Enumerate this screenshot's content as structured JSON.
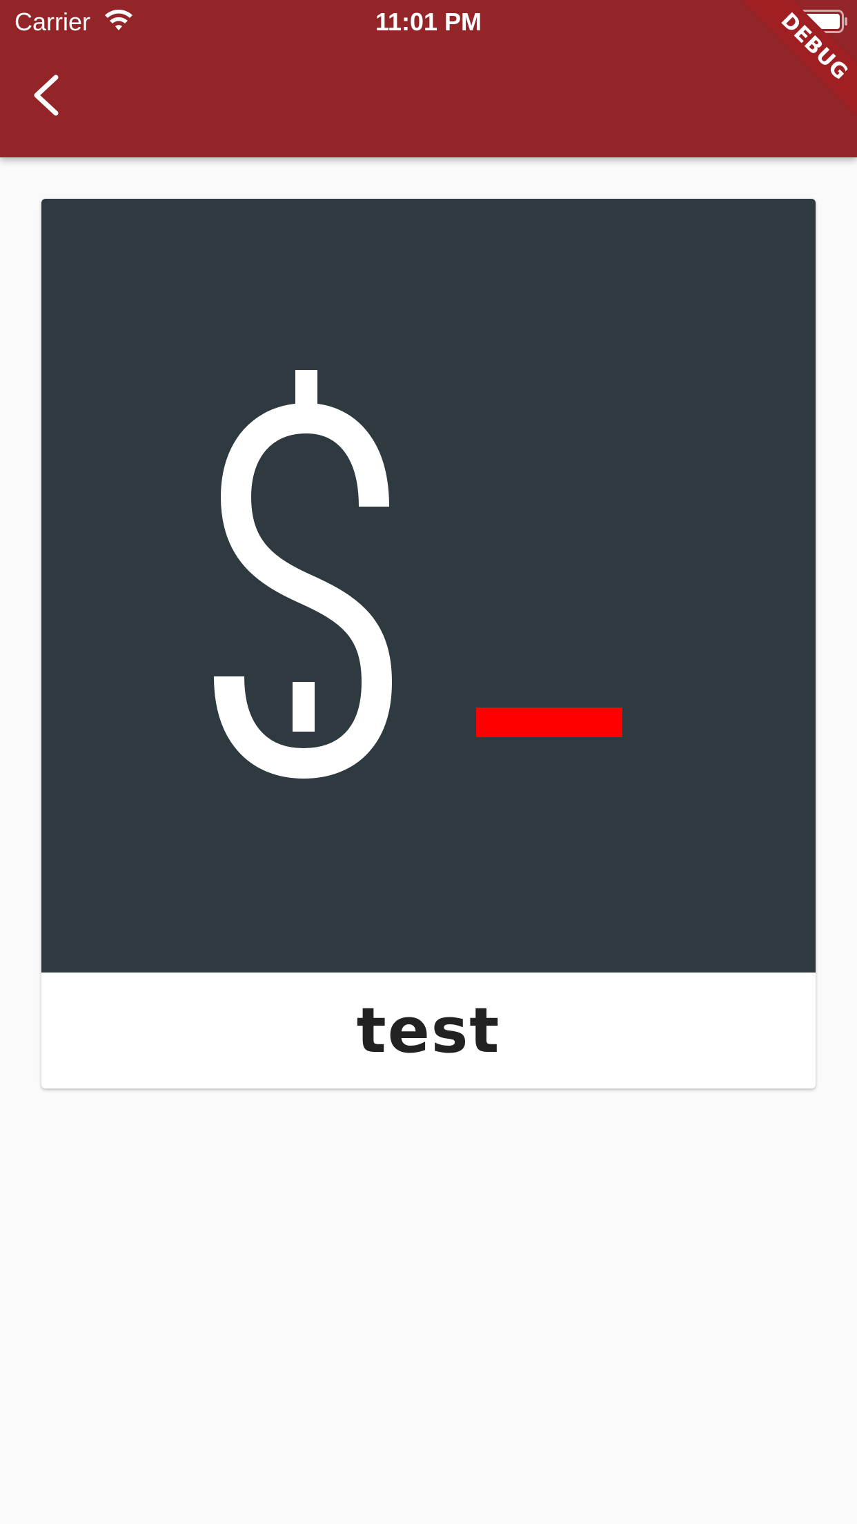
{
  "status_bar": {
    "carrier": "Carrier",
    "time": "11:01 PM",
    "wifi_icon": "wifi-icon",
    "battery_icon": "battery-icon"
  },
  "app_bar": {
    "back_icon": "chevron-left-icon",
    "background_color": "#932528"
  },
  "debug_banner": {
    "label": "DEBUG"
  },
  "card": {
    "image": {
      "description_icon": "terminal-icon",
      "background_color": "#2e3a3f",
      "symbol": "$",
      "cursor_color": "#ff0000"
    },
    "title": "test"
  }
}
